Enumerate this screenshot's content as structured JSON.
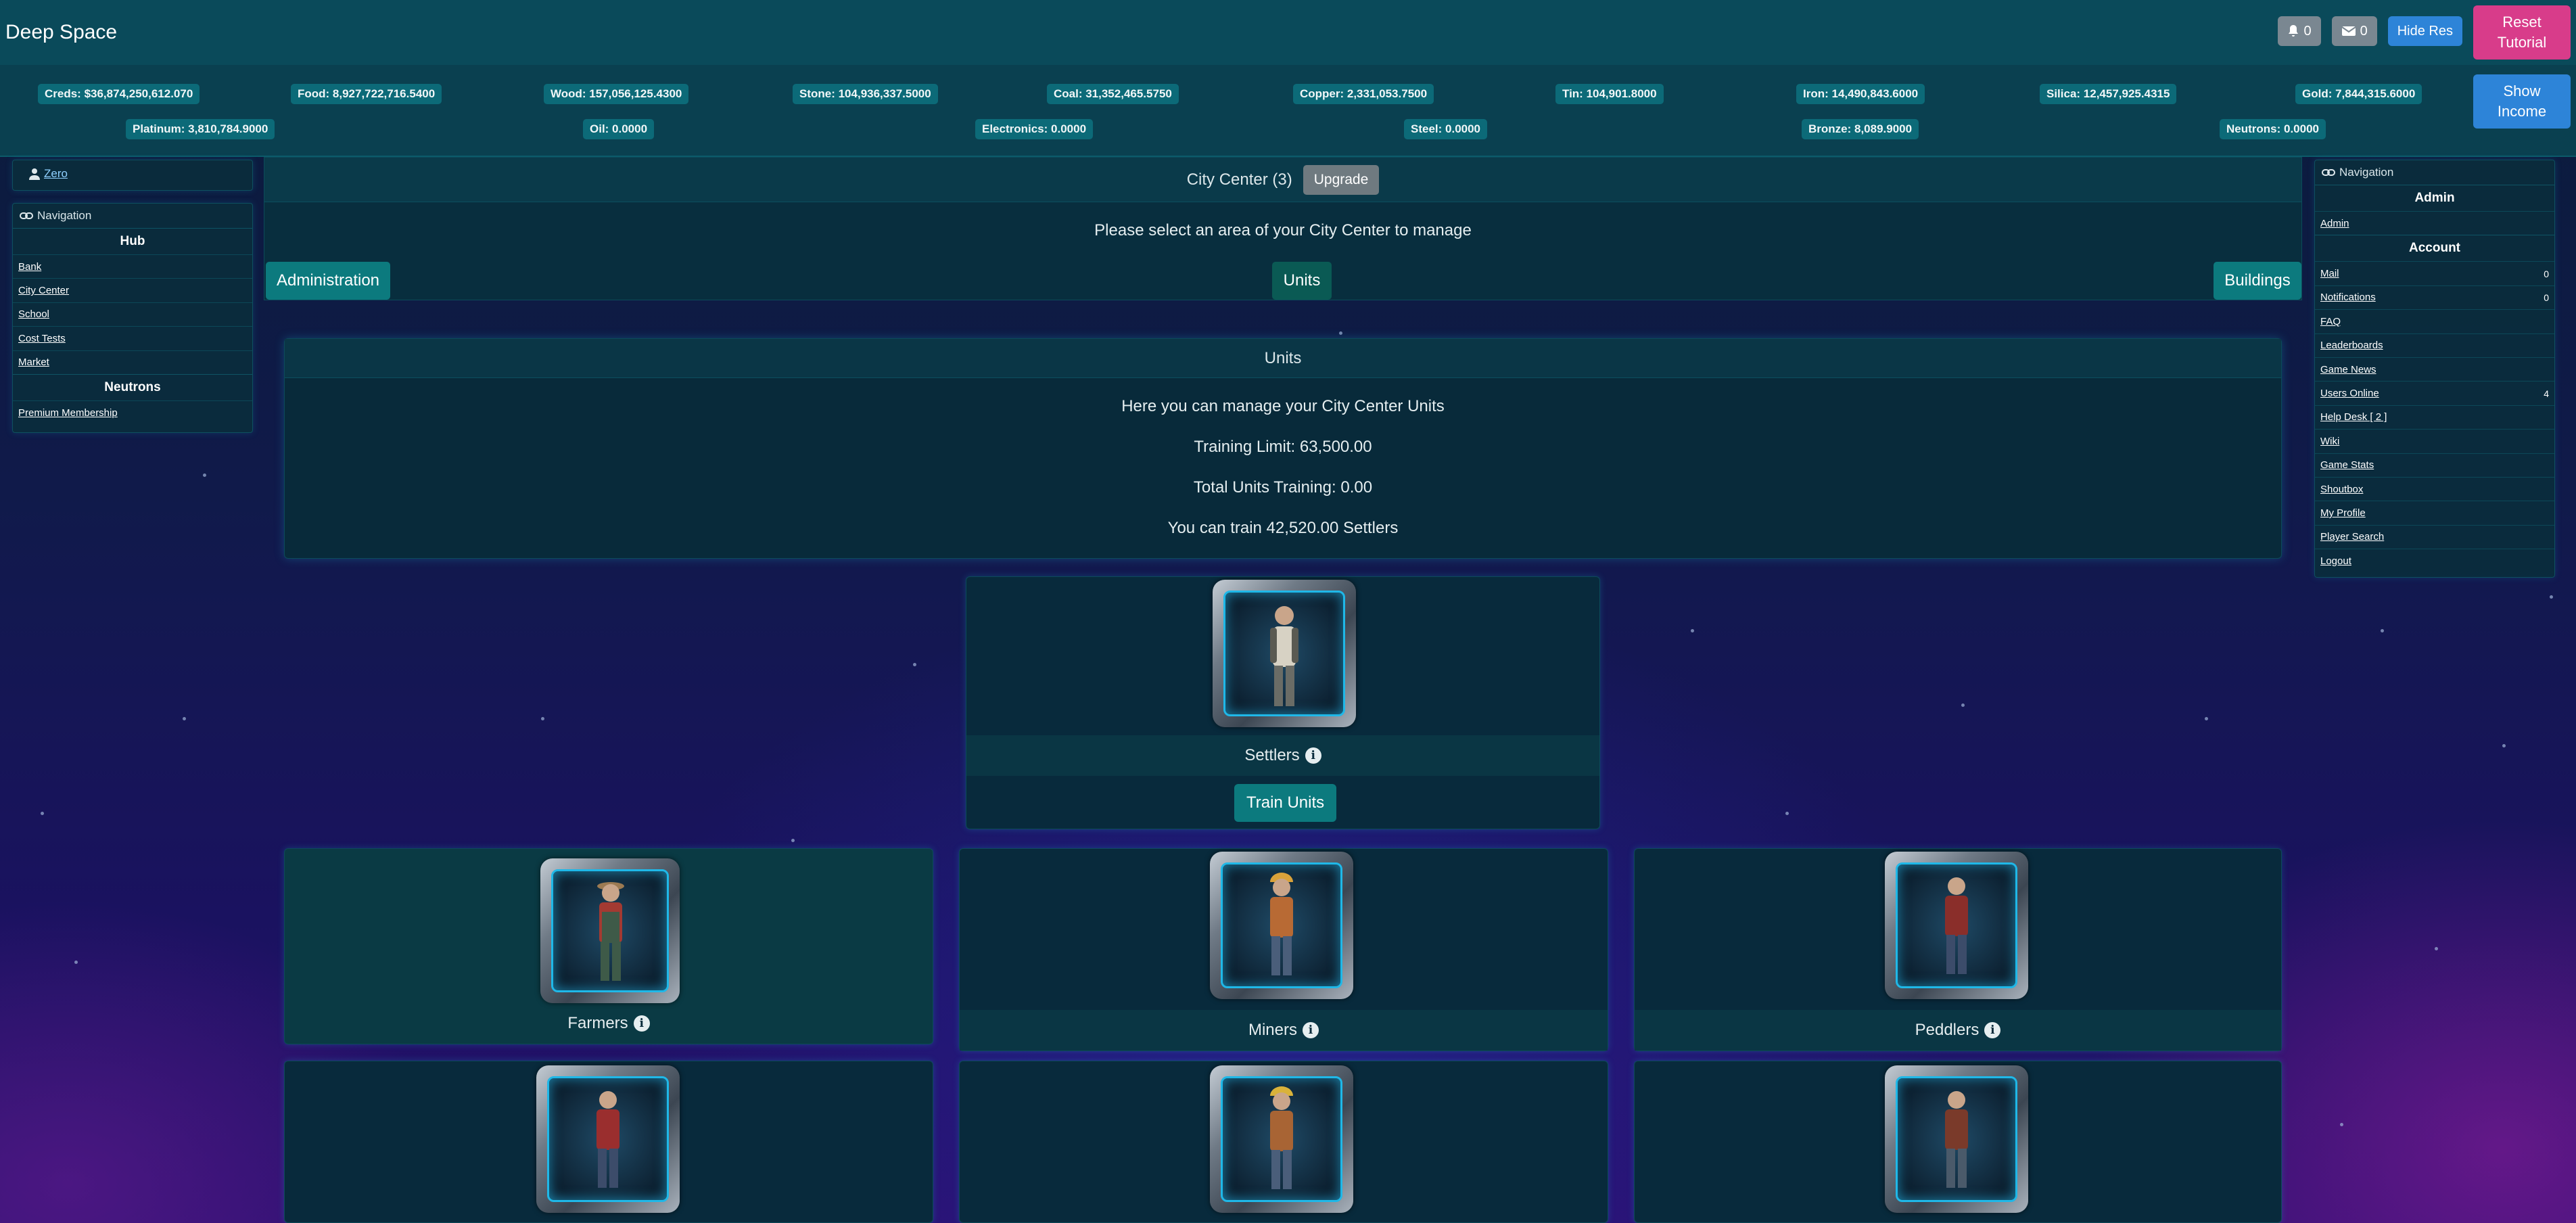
{
  "header": {
    "title": "Deep Space",
    "notifications_count": "0",
    "mail_count": "0",
    "hide_res_label": "Hide Res",
    "reset_tutorial_line1": "Reset",
    "reset_tutorial_line2": "Tutorial"
  },
  "resources": {
    "row1": [
      "Creds: $36,874,250,612.070",
      "Food: 8,927,722,716.5400",
      "Wood: 157,056,125.4300",
      "Stone: 104,936,337.5000",
      "Coal: 31,352,465.5750",
      "Copper: 2,331,053.7500",
      "Tin: 104,901.8000",
      "Iron: 14,490,843.6000",
      "Silica: 12,457,925.4315",
      "Gold: 7,844,315.6000"
    ],
    "row2": [
      "Platinum: 3,810,784.9000",
      "Oil: 0.0000",
      "Electronics: 0.0000",
      "Steel: 0.0000",
      "Bronze: 8,089.9000",
      "Neutrons: 0.0000"
    ],
    "show_income_line1": "Show",
    "show_income_line2": "Income"
  },
  "left_sidebar": {
    "user": "Zero",
    "nav_title": "Navigation",
    "hub_title": "Hub",
    "hub_items": [
      "Bank",
      "City Center",
      "School",
      "Cost Tests",
      "Market"
    ],
    "neutrons_title": "Neutrons",
    "neutrons_items": [
      "Premium Membership"
    ]
  },
  "right_sidebar": {
    "nav_title": "Navigation",
    "admin_title": "Admin",
    "admin_items": [
      "Admin"
    ],
    "account_title": "Account",
    "account_items": [
      {
        "label": "Mail",
        "count": "0"
      },
      {
        "label": "Notifications",
        "count": "0"
      },
      {
        "label": "FAQ",
        "count": ""
      },
      {
        "label": "Leaderboards",
        "count": ""
      },
      {
        "label": "Game News",
        "count": ""
      },
      {
        "label": "Users Online",
        "count": "4"
      },
      {
        "label": "Help Desk [ 2 ]",
        "count": ""
      },
      {
        "label": "Wiki",
        "count": ""
      },
      {
        "label": "Game Stats",
        "count": ""
      },
      {
        "label": "Shoutbox",
        "count": ""
      },
      {
        "label": "My Profile",
        "count": ""
      },
      {
        "label": "Player Search",
        "count": ""
      },
      {
        "label": "Logout",
        "count": ""
      }
    ]
  },
  "city_center": {
    "title": "City Center (3)",
    "upgrade_label": "Upgrade",
    "prompt": "Please select an area of your City Center to manage",
    "tabs": {
      "administration": "Administration",
      "units": "Units",
      "buildings": "Buildings"
    }
  },
  "units": {
    "title": "Units",
    "line1": "Here you can manage your City Center Units",
    "line2": "Training Limit: 63,500.00",
    "line3": "Total Units Training: 0.00",
    "line4": "You can train 42,520.00 Settlers",
    "settlers_label": "Settlers",
    "train_label": "Train Units",
    "row1_labels": [
      "Farmers",
      "Miners",
      "Peddlers"
    ]
  }
}
